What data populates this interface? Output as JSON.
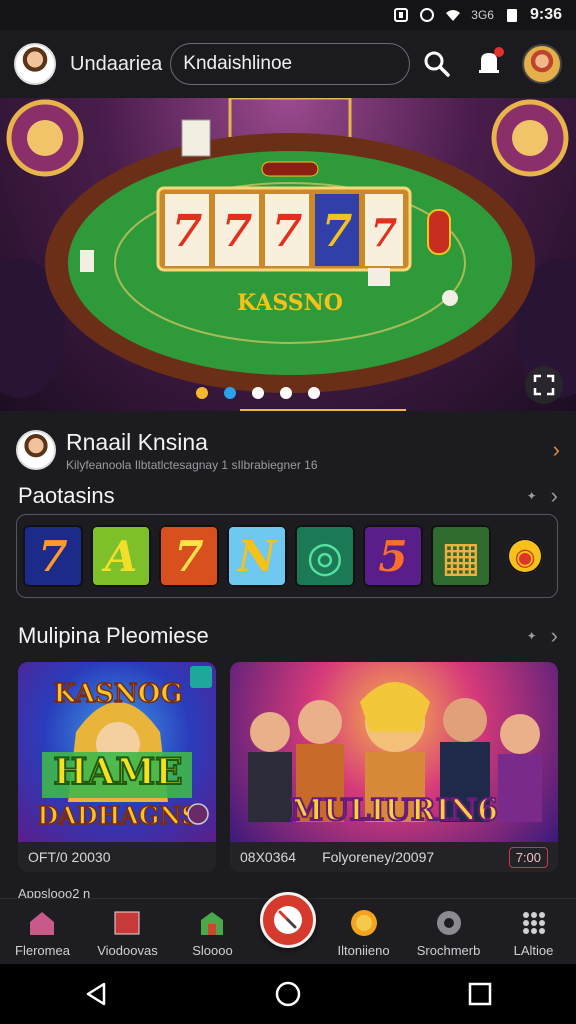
{
  "status_bar": {
    "network": "3G6",
    "time": "9:36"
  },
  "app_bar": {
    "title": "Undaariea",
    "search_value": "Kndaishlinoe",
    "icons": [
      "search-icon",
      "notification-icon"
    ],
    "notification_badge_color": "#e0312b"
  },
  "hero": {
    "table_text": "KASSNO",
    "reels": [
      "7",
      "7",
      "7",
      "7",
      "7"
    ],
    "active_dot": 1,
    "dot_count": 5
  },
  "featured": {
    "title": "Rnaail Knsina",
    "subtitle": "Kilyfeanoola Ilbtatlctesagnay 1 sIlbrabiegner 16"
  },
  "section_games": {
    "title": "Paotasins"
  },
  "games": [
    {
      "glyph": "7",
      "bg": "#1c2a8a",
      "fg": "#ff9a2a"
    },
    {
      "glyph": "A",
      "bg": "#7fbf2a",
      "fg": "#f0e02a"
    },
    {
      "glyph": "7",
      "bg": "#d8501e",
      "fg": "#ffe14a"
    },
    {
      "glyph": "N",
      "bg": "#6fc8f0",
      "fg": "#f5c21a"
    },
    {
      "glyph": "◎",
      "bg": "#1b7a55",
      "fg": "#55e0a0"
    },
    {
      "glyph": "5",
      "bg": "#5a1e8a",
      "fg": "#ff6d2a"
    },
    {
      "glyph": "▦",
      "bg": "#2f6a2f",
      "fg": "#f0b040"
    },
    {
      "glyph": "◉",
      "bg": "#1c1c20",
      "fg": "#e0312b"
    }
  ],
  "section_promos": {
    "title": "Mulipina Pleomiese"
  },
  "promos": [
    {
      "img_title_top": "KASNOG",
      "img_title_mid": "HAME",
      "img_title_bottom": "DADHAGNS",
      "date": "OFT/0 20030"
    },
    {
      "img_title": "MULIURIN6",
      "code": "08X0364",
      "date": "Folyoreney/20097",
      "time": "7:00"
    }
  ],
  "bottom_strip_text": "Appslooo2 n",
  "bottom_nav": [
    {
      "label": "Fleromea",
      "icon": "home-icon"
    },
    {
      "label": "Viodoovas",
      "icon": "video-icon"
    },
    {
      "label": "Sloooo",
      "icon": "store-icon"
    },
    {
      "label": "Iltoniieno",
      "icon": "sun-icon"
    },
    {
      "label": "Srochmerb",
      "icon": "gear-icon"
    },
    {
      "label": "LAltioe",
      "icon": "grid-icon"
    }
  ],
  "colors": {
    "accent": "#f5b82e",
    "fab": "#d63a2c",
    "table_felt": "#2f9a3a"
  }
}
